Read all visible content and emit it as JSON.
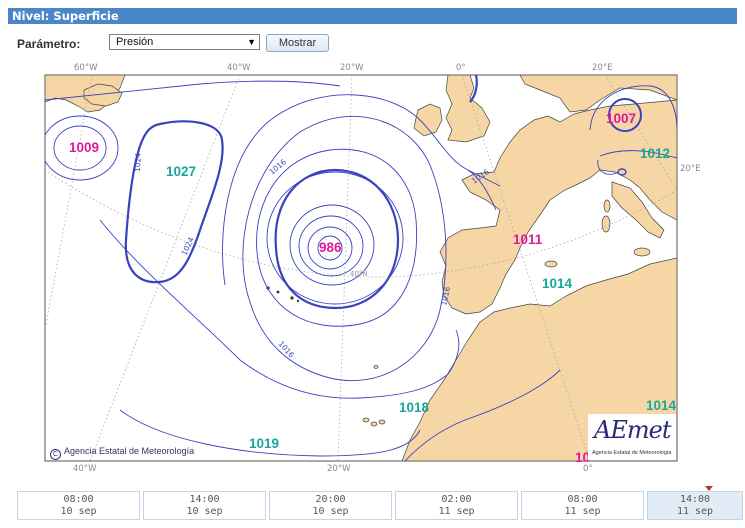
{
  "header": {
    "title": "Nivel: Superficie"
  },
  "controls": {
    "parameter_label": "Parámetro:",
    "parameter_value": "Presión",
    "show_button": "Mostrar"
  },
  "map": {
    "top_longitudes": [
      "60°W",
      "40°W",
      "20°W",
      "0°",
      "20°E"
    ],
    "bottom_longitudes": [
      "40°W",
      "20°W",
      "0°"
    ],
    "right_longitude": "20°E",
    "inner_latitude": "40°N",
    "pressure_centers": [
      {
        "value": "1009",
        "kind": "low"
      },
      {
        "value": "1027",
        "kind": "high"
      },
      {
        "value": "986",
        "kind": "low"
      },
      {
        "value": "1007",
        "kind": "low"
      },
      {
        "value": "1012",
        "kind": "high"
      },
      {
        "value": "1011",
        "kind": "low"
      },
      {
        "value": "1014",
        "kind": "high"
      },
      {
        "value": "1018",
        "kind": "high"
      },
      {
        "value": "1014",
        "kind": "high"
      },
      {
        "value": "1019",
        "kind": "high"
      },
      {
        "value": "10",
        "kind": "low"
      }
    ],
    "isobar_labels": [
      "1024",
      "1024",
      "1016",
      "1016",
      "1016",
      "1016"
    ],
    "colors": {
      "ocean": "#ffffff",
      "land": "#f5d6a4",
      "isobar": "#3a42c0",
      "low_label": "#e0189b",
      "high_label": "#1aa79a"
    }
  },
  "copyright": "Agencia Estatal de Meteorología",
  "logo": {
    "word": "AEmet",
    "subtitle": "Agencia Estatal de Meteorología"
  },
  "timeline": [
    {
      "time": "08:00",
      "date": "10 sep",
      "active": false
    },
    {
      "time": "14:00",
      "date": "10 sep",
      "active": false
    },
    {
      "time": "20:00",
      "date": "10 sep",
      "active": false
    },
    {
      "time": "02:00",
      "date": "11 sep",
      "active": false
    },
    {
      "time": "08:00",
      "date": "11 sep",
      "active": false
    },
    {
      "time": "14:00",
      "date": "11 sep",
      "active": true
    }
  ]
}
